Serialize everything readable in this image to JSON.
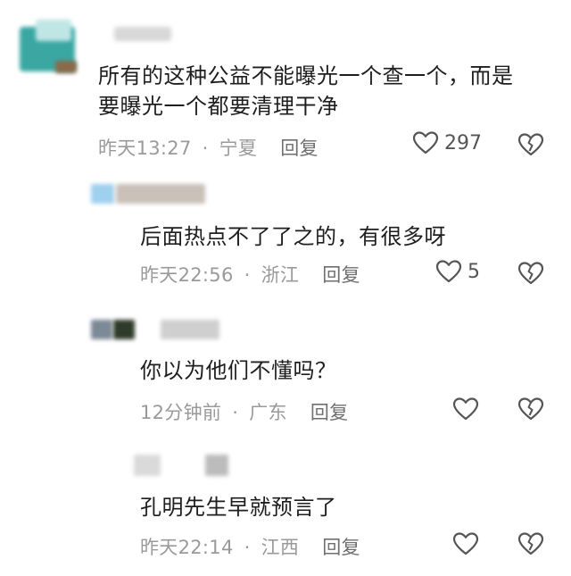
{
  "comments": [
    {
      "text_line1": "所有的这种公益不能曝光一个查一个，而是",
      "text_line2": "要曝光一个都要清理干净",
      "time": "昨天13:27",
      "location": "宁夏",
      "reply_label": "回复",
      "likes": "297"
    },
    {
      "text": "后面热点不了了之的，有很多呀",
      "time": "昨天22:56",
      "location": "浙江",
      "reply_label": "回复",
      "likes": "5"
    },
    {
      "text": "你以为他们不懂吗？",
      "time": "12分钟前",
      "location": "广东",
      "reply_label": "回复"
    },
    {
      "text": "孔明先生早就预言了",
      "time": "昨天22:14",
      "location": "江西",
      "reply_label": "回复"
    }
  ],
  "separator": "·",
  "icons": {
    "like": "heart-outline-icon",
    "dislike": "broken-heart-icon"
  },
  "colors": {
    "text": "#1e1e1e",
    "meta": "#9a9a9a",
    "reply": "#6f6f6f",
    "icon": "#555555"
  }
}
